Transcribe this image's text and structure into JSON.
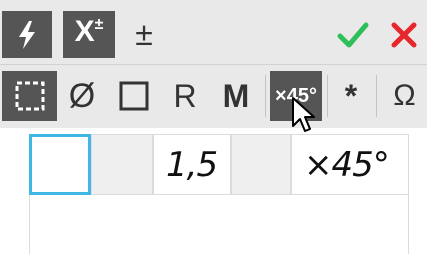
{
  "toolbar_top": {
    "buttons": [
      {
        "id": "special-symbol",
        "icon": "lightning-icon"
      },
      {
        "id": "superscript",
        "label": "X",
        "sup": "±",
        "icon": "superscript-icon"
      },
      {
        "id": "plus-minus",
        "label": "±"
      },
      {
        "id": "ok",
        "icon": "checkmark-icon",
        "color": "#2fbf5a"
      },
      {
        "id": "cancel",
        "icon": "close-icon",
        "color": "#e8262b"
      }
    ]
  },
  "toolbar_bottom": {
    "buttons": [
      {
        "id": "frame",
        "icon": "dashed-square-icon"
      },
      {
        "id": "diameter",
        "label": "Ø"
      },
      {
        "id": "square",
        "icon": "square-icon"
      },
      {
        "id": "radius",
        "label": "R"
      },
      {
        "id": "metric",
        "label": "M"
      },
      {
        "id": "chamfer",
        "label": "×45°",
        "active": true
      },
      {
        "id": "star",
        "label": "*"
      },
      {
        "id": "omega",
        "label": "Ω"
      }
    ]
  },
  "editor": {
    "cells": [
      {
        "kind": "active",
        "value": ""
      },
      {
        "kind": "gray",
        "value": ""
      },
      {
        "kind": "white",
        "value": "1,5"
      },
      {
        "kind": "gray",
        "value": ""
      },
      {
        "kind": "white",
        "value": "×45°"
      }
    ]
  },
  "colors": {
    "accent_active": "#3fb6e3",
    "dark_button": "#555555",
    "toolbar_bg": "#e9e9e9"
  }
}
